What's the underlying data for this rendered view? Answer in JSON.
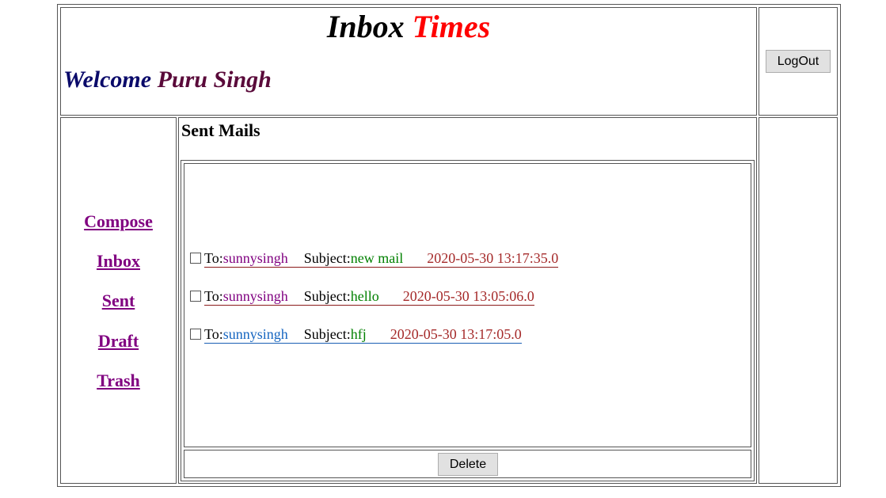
{
  "header": {
    "title_word1": "Inbox",
    "title_word2": "Times",
    "welcome_label": "Welcome",
    "user_name": "Puru Singh",
    "logout_label": "LogOut"
  },
  "nav": {
    "items": [
      {
        "label": "Compose"
      },
      {
        "label": "Inbox"
      },
      {
        "label": "Sent"
      },
      {
        "label": "Draft"
      },
      {
        "label": "Trash"
      }
    ]
  },
  "main": {
    "section_title": "Sent Mails",
    "to_label": "To:",
    "subject_label": "Subject:",
    "mails": [
      {
        "to": "sunnysingh",
        "subject": "new mail",
        "date": "2020-05-30 13:17:35.0"
      },
      {
        "to": "sunnysingh",
        "subject": "hello",
        "date": "2020-05-30 13:05:06.0"
      },
      {
        "to": "sunnysingh",
        "subject": "hfj",
        "date": "2020-05-30 13:17:05.0"
      }
    ],
    "delete_label": "Delete"
  }
}
